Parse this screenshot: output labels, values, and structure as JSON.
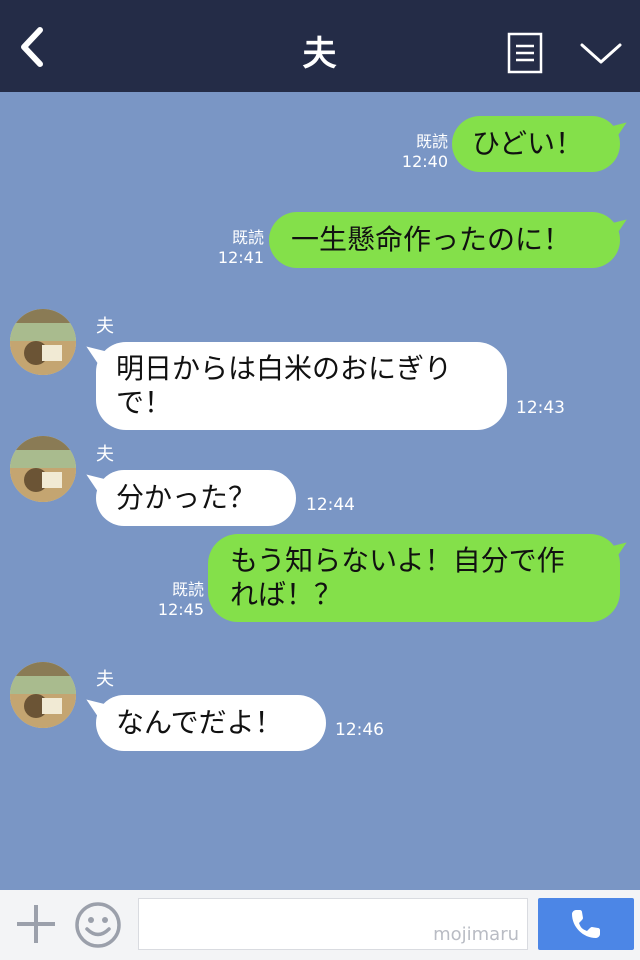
{
  "header": {
    "title": "夫"
  },
  "messages": [
    {
      "side": "sent",
      "text": "ひどい！",
      "read": "既読",
      "time": "12:40"
    },
    {
      "side": "sent",
      "text": "一生懸命作ったのに！",
      "read": "既読",
      "time": "12:41"
    },
    {
      "side": "received",
      "sender": "夫",
      "lines": [
        "明日からは白米のおにぎり",
        "で！"
      ],
      "time": "12:43"
    },
    {
      "side": "received",
      "sender": "夫",
      "text": "分かった？",
      "time": "12:44"
    },
    {
      "side": "sent",
      "lines": [
        "もう知らないよ！自分で作",
        "れば！？"
      ],
      "read": "既読",
      "time": "12:45"
    },
    {
      "side": "received",
      "sender": "夫",
      "text": "なんでだよ！",
      "time": "12:46"
    }
  ],
  "footer": {
    "watermark": "mojimaru"
  },
  "icons": {
    "back": "chevron-left-icon",
    "menu": "list-menu-icon",
    "collapse": "chevron-down-icon",
    "plus": "plus-icon",
    "emoji": "smiley-icon",
    "call": "phone-icon"
  },
  "colors": {
    "header_bg": "#242c47",
    "chat_bg": "#7a96c5",
    "sent_bubble": "#84e04a",
    "received_bubble": "#ffffff",
    "call_button": "#4c86e6"
  }
}
